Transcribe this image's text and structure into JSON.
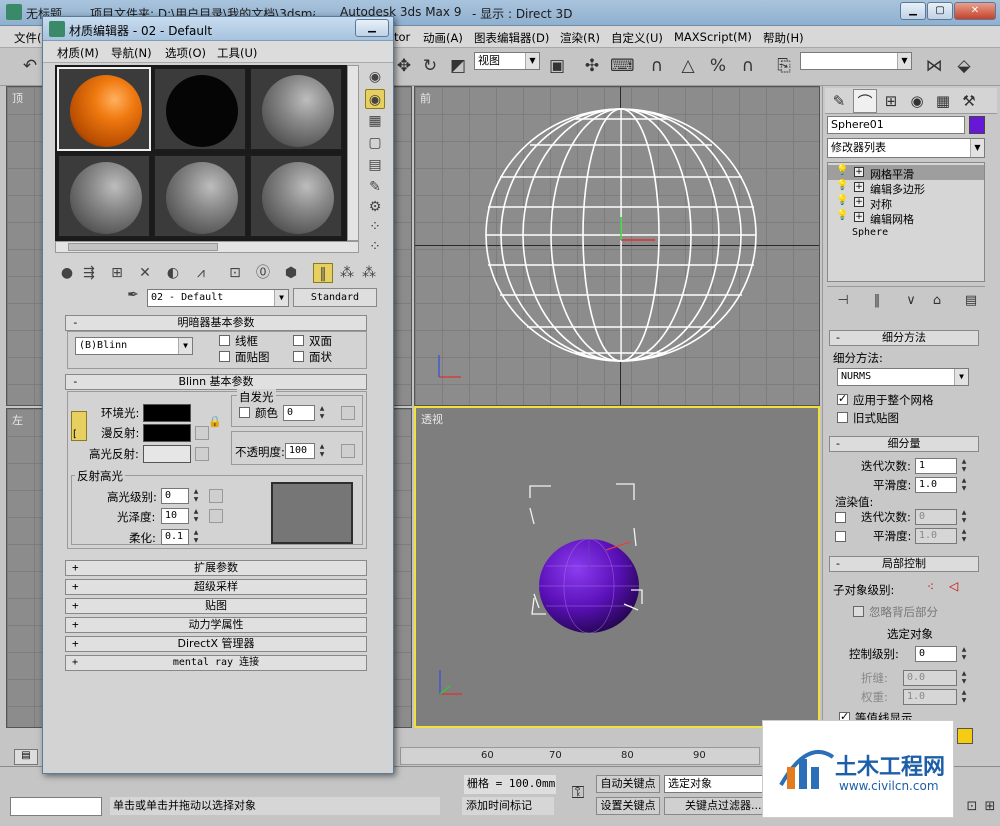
{
  "app": {
    "title_left": "无标题",
    "title_project": "项目文件夹: D:\\用户目录\\我的文档\\3dsmax",
    "title_app": "Autodesk 3ds Max 9",
    "title_display": "- 显示 : Direct 3D"
  },
  "menu": [
    "文件(F)",
    "tor",
    "动画(A)",
    "图表编辑器(D)",
    "渲染(R)",
    "自定义(U)",
    "MAXScript(M)",
    "帮助(H)"
  ],
  "toolbar": {
    "refcoord": "视图"
  },
  "viewports": {
    "top_label": "顶",
    "front_label": "前",
    "left_label": "左",
    "persp_label": "透视"
  },
  "cmd": {
    "object_name": "Sphere01",
    "modifier_list": "修改器列表",
    "stack": [
      "网格平滑",
      "编辑多边形",
      "对称",
      "编辑网格"
    ],
    "base": "Sphere",
    "subdiv_method_header": "细分方法",
    "subdiv_method_label": "细分方法:",
    "subdiv_method_value": "NURMS",
    "apply_whole": "应用于整个网格",
    "old_map": "旧式贴图",
    "subdiv_amount_header": "细分量",
    "iterations_label": "迭代次数:",
    "iterations_value": "1",
    "smoothness_label": "平滑度:",
    "smoothness_value": "1.0",
    "render_values": "渲染值:",
    "r_iterations_label": "迭代次数:",
    "r_iterations_value": "0",
    "r_smoothness_label": "平滑度:",
    "r_smoothness_value": "1.0",
    "local_control": "局部控制",
    "sublevel": "子对象级别:",
    "ignore_backface": "忽略背后部分",
    "select_obj": "选定对象",
    "control_level": "控制级别:",
    "control_level_value": "0",
    "crease": "折缝:",
    "crease_value": "0.0",
    "weight": "权重:",
    "weight_value": "1.0",
    "isoline": "等值线显示"
  },
  "mated": {
    "title": "材质编辑器 - 02 - Default",
    "menu": [
      "材质(M)",
      "导航(N)",
      "选项(O)",
      "工具(U)"
    ],
    "mat_name": "02 - Default",
    "mat_type": "Standard",
    "shader_header": "明暗器基本参数",
    "shader": "(B)Blinn",
    "wire": "线框",
    "two_sided": "双面",
    "face_map": "面贴图",
    "faceted": "面状",
    "blinn_header": "Blinn 基本参数",
    "self_illum": "自发光",
    "color": "颜色",
    "color_value": "0",
    "ambient": "环境光:",
    "diffuse": "漫反射:",
    "specular": "高光反射:",
    "opacity": "不透明度:",
    "opacity_value": "100",
    "spec_hl": "反射高光",
    "spec_level": "高光级别:",
    "spec_level_value": "0",
    "gloss": "光泽度:",
    "gloss_value": "10",
    "soften": "柔化:",
    "soften_value": "0.1",
    "rollouts": [
      "扩展参数",
      "超级采样",
      "贴图",
      "动力学属性",
      "DirectX 管理器",
      "mental ray 连接"
    ],
    "colors": {
      "ambient": "#000000",
      "diffuse": "#000000",
      "specular": "#e6e6e6"
    }
  },
  "status": {
    "ruler": [
      "60",
      "70",
      "80",
      "90"
    ],
    "grid": "栅格 = 100.0mm",
    "autokey": "自动关键点",
    "selected": "选定对象",
    "setkey": "设置关键点",
    "keyfilter": "关键点过滤器...",
    "prompt": "单击或单击并拖动以选择对象",
    "add_time_tag": "添加时间标记"
  },
  "watermark": {
    "name": "土木工程网",
    "url": "www.civilcn.com"
  }
}
